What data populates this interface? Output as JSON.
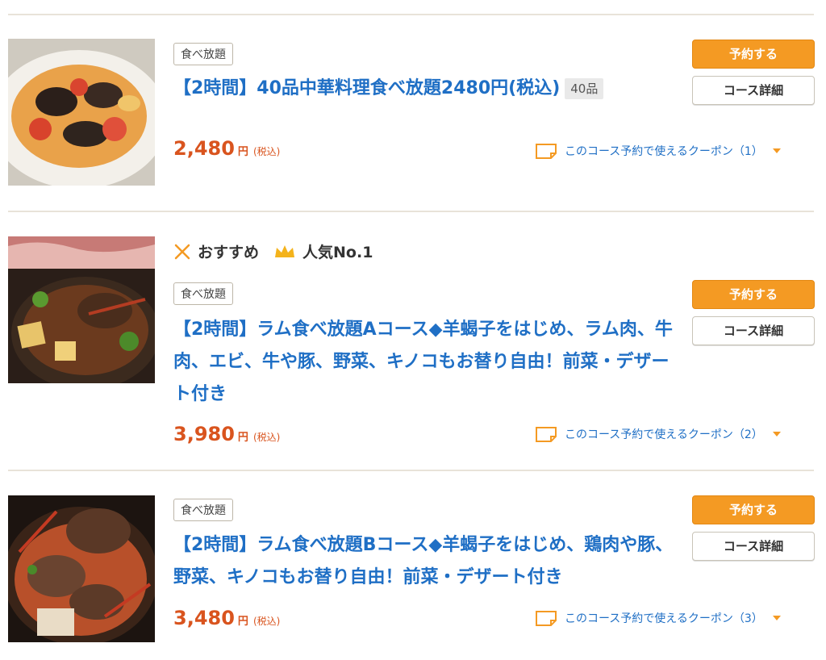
{
  "colors": {
    "accent_orange": "#f49a23",
    "link_blue": "#1f6fc5",
    "price_red": "#d9541e"
  },
  "courses": [
    {
      "tag": "食べ放題",
      "title": "【2時間】40品中華料理食べ放題2480円(税込)",
      "item_count": "40品",
      "price": "2,480",
      "currency": "円",
      "tax": "(税込)",
      "reserve_label": "予約する",
      "detail_label": "コース詳細",
      "coupon_text": "このコース予約で使えるクーポン（1）"
    },
    {
      "badges": [
        {
          "icon": "utensils-icon",
          "label": "おすすめ"
        },
        {
          "icon": "crown-icon",
          "label": "人気No.1"
        }
      ],
      "tag": "食べ放題",
      "title": "【2時間】ラム食べ放題Aコース◆羊蝎子をはじめ、ラム肉、牛肉、エビ、牛や豚、野菜、キノコもお替り自由！前菜・デザート付き",
      "price": "3,980",
      "currency": "円",
      "tax": "(税込)",
      "reserve_label": "予約する",
      "detail_label": "コース詳細",
      "coupon_text": "このコース予約で使えるクーポン（2）"
    },
    {
      "tag": "食べ放題",
      "title": "【2時間】ラム食べ放題Bコース◆羊蝎子をはじめ、鶏肉や豚、野菜、キノコもお替り自由！前菜・デザート付き",
      "price": "3,480",
      "currency": "円",
      "tax": "(税込)",
      "reserve_label": "予約する",
      "detail_label": "コース詳細",
      "coupon_text": "このコース予約で使えるクーポン（3）"
    }
  ]
}
